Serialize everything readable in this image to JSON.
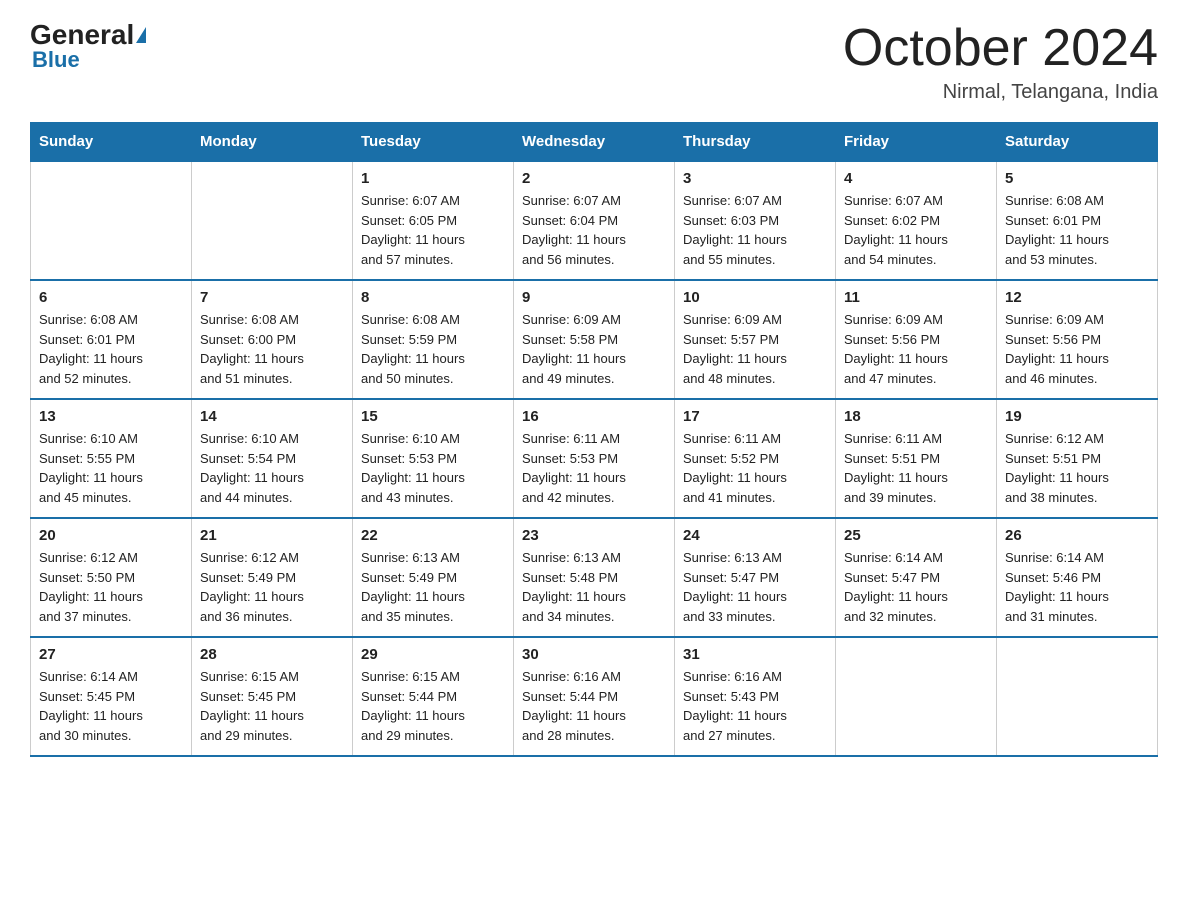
{
  "logo": {
    "general": "General",
    "triangle": "▶",
    "blue": "Blue"
  },
  "title": "October 2024",
  "subtitle": "Nirmal, Telangana, India",
  "days_of_week": [
    "Sunday",
    "Monday",
    "Tuesday",
    "Wednesday",
    "Thursday",
    "Friday",
    "Saturday"
  ],
  "weeks": [
    [
      {
        "day": "",
        "info": ""
      },
      {
        "day": "",
        "info": ""
      },
      {
        "day": "1",
        "info": "Sunrise: 6:07 AM\nSunset: 6:05 PM\nDaylight: 11 hours\nand 57 minutes."
      },
      {
        "day": "2",
        "info": "Sunrise: 6:07 AM\nSunset: 6:04 PM\nDaylight: 11 hours\nand 56 minutes."
      },
      {
        "day": "3",
        "info": "Sunrise: 6:07 AM\nSunset: 6:03 PM\nDaylight: 11 hours\nand 55 minutes."
      },
      {
        "day": "4",
        "info": "Sunrise: 6:07 AM\nSunset: 6:02 PM\nDaylight: 11 hours\nand 54 minutes."
      },
      {
        "day": "5",
        "info": "Sunrise: 6:08 AM\nSunset: 6:01 PM\nDaylight: 11 hours\nand 53 minutes."
      }
    ],
    [
      {
        "day": "6",
        "info": "Sunrise: 6:08 AM\nSunset: 6:01 PM\nDaylight: 11 hours\nand 52 minutes."
      },
      {
        "day": "7",
        "info": "Sunrise: 6:08 AM\nSunset: 6:00 PM\nDaylight: 11 hours\nand 51 minutes."
      },
      {
        "day": "8",
        "info": "Sunrise: 6:08 AM\nSunset: 5:59 PM\nDaylight: 11 hours\nand 50 minutes."
      },
      {
        "day": "9",
        "info": "Sunrise: 6:09 AM\nSunset: 5:58 PM\nDaylight: 11 hours\nand 49 minutes."
      },
      {
        "day": "10",
        "info": "Sunrise: 6:09 AM\nSunset: 5:57 PM\nDaylight: 11 hours\nand 48 minutes."
      },
      {
        "day": "11",
        "info": "Sunrise: 6:09 AM\nSunset: 5:56 PM\nDaylight: 11 hours\nand 47 minutes."
      },
      {
        "day": "12",
        "info": "Sunrise: 6:09 AM\nSunset: 5:56 PM\nDaylight: 11 hours\nand 46 minutes."
      }
    ],
    [
      {
        "day": "13",
        "info": "Sunrise: 6:10 AM\nSunset: 5:55 PM\nDaylight: 11 hours\nand 45 minutes."
      },
      {
        "day": "14",
        "info": "Sunrise: 6:10 AM\nSunset: 5:54 PM\nDaylight: 11 hours\nand 44 minutes."
      },
      {
        "day": "15",
        "info": "Sunrise: 6:10 AM\nSunset: 5:53 PM\nDaylight: 11 hours\nand 43 minutes."
      },
      {
        "day": "16",
        "info": "Sunrise: 6:11 AM\nSunset: 5:53 PM\nDaylight: 11 hours\nand 42 minutes."
      },
      {
        "day": "17",
        "info": "Sunrise: 6:11 AM\nSunset: 5:52 PM\nDaylight: 11 hours\nand 41 minutes."
      },
      {
        "day": "18",
        "info": "Sunrise: 6:11 AM\nSunset: 5:51 PM\nDaylight: 11 hours\nand 39 minutes."
      },
      {
        "day": "19",
        "info": "Sunrise: 6:12 AM\nSunset: 5:51 PM\nDaylight: 11 hours\nand 38 minutes."
      }
    ],
    [
      {
        "day": "20",
        "info": "Sunrise: 6:12 AM\nSunset: 5:50 PM\nDaylight: 11 hours\nand 37 minutes."
      },
      {
        "day": "21",
        "info": "Sunrise: 6:12 AM\nSunset: 5:49 PM\nDaylight: 11 hours\nand 36 minutes."
      },
      {
        "day": "22",
        "info": "Sunrise: 6:13 AM\nSunset: 5:49 PM\nDaylight: 11 hours\nand 35 minutes."
      },
      {
        "day": "23",
        "info": "Sunrise: 6:13 AM\nSunset: 5:48 PM\nDaylight: 11 hours\nand 34 minutes."
      },
      {
        "day": "24",
        "info": "Sunrise: 6:13 AM\nSunset: 5:47 PM\nDaylight: 11 hours\nand 33 minutes."
      },
      {
        "day": "25",
        "info": "Sunrise: 6:14 AM\nSunset: 5:47 PM\nDaylight: 11 hours\nand 32 minutes."
      },
      {
        "day": "26",
        "info": "Sunrise: 6:14 AM\nSunset: 5:46 PM\nDaylight: 11 hours\nand 31 minutes."
      }
    ],
    [
      {
        "day": "27",
        "info": "Sunrise: 6:14 AM\nSunset: 5:45 PM\nDaylight: 11 hours\nand 30 minutes."
      },
      {
        "day": "28",
        "info": "Sunrise: 6:15 AM\nSunset: 5:45 PM\nDaylight: 11 hours\nand 29 minutes."
      },
      {
        "day": "29",
        "info": "Sunrise: 6:15 AM\nSunset: 5:44 PM\nDaylight: 11 hours\nand 29 minutes."
      },
      {
        "day": "30",
        "info": "Sunrise: 6:16 AM\nSunset: 5:44 PM\nDaylight: 11 hours\nand 28 minutes."
      },
      {
        "day": "31",
        "info": "Sunrise: 6:16 AM\nSunset: 5:43 PM\nDaylight: 11 hours\nand 27 minutes."
      },
      {
        "day": "",
        "info": ""
      },
      {
        "day": "",
        "info": ""
      }
    ]
  ]
}
